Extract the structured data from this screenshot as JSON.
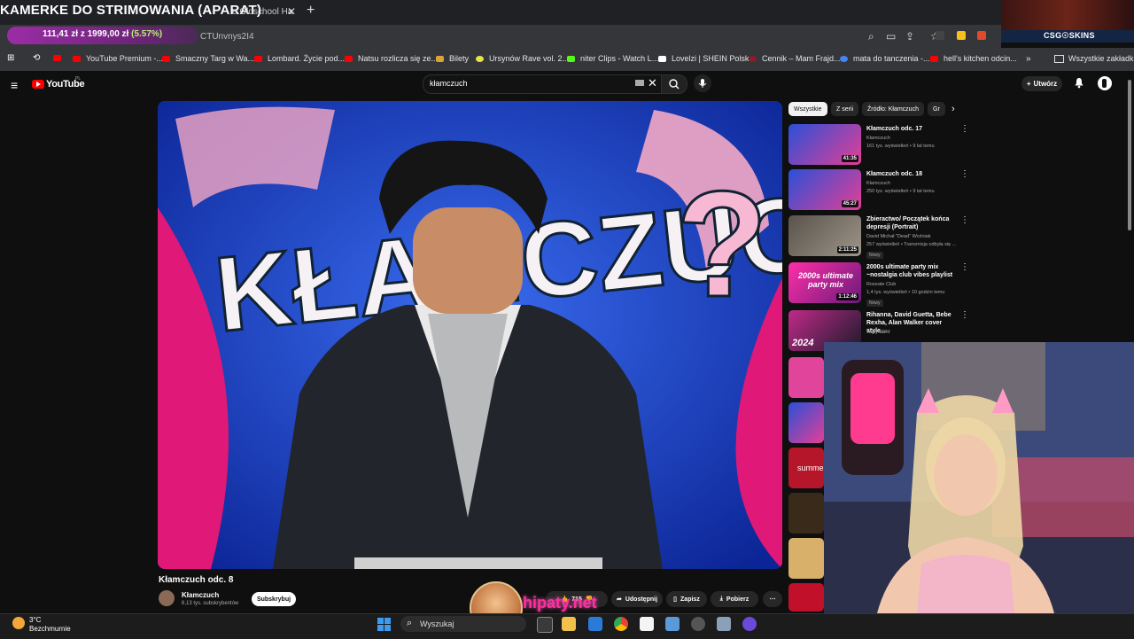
{
  "stream_overlay": {
    "title": "KAMERKE DO STRIMOWANIA (APARAT)",
    "goal_current": "111,41 zł",
    "goal_sep": "z",
    "goal_target": "1999,00 zł",
    "goal_pct": "(5.57%)",
    "sponsor": "CSG☉SKINS",
    "watermark": "hipaty.net"
  },
  "browser": {
    "tab_title_fragment": "e Oldschool Ha",
    "url_fragment": "CTUnvnys2I4",
    "bookmarks": [
      "YouTube Premium -...",
      "Smaczny Targ w Wa...",
      "Lombard. Życie pod...",
      "Natsu rozlicza się ze...",
      "Bilety",
      "Ursynów Rave vol. 2...",
      "niter Clips - Watch L...",
      "Lovelzi | SHEIN Polska",
      "Cennik – Mam Frajd...",
      "mata do tanczenia -...",
      "hell's kitchen odcin..."
    ],
    "all_bookmarks": "Wszystkie zakładki"
  },
  "youtube": {
    "logo_text": "YouTube",
    "region": "PL",
    "search_value": "kłamczuch",
    "create_label": "Utwórz",
    "video_title": "Kłamczuch odc. 8",
    "channel_name": "Kłamczuch",
    "channel_subs": "6,13 tys. subskrybentów",
    "subscribe_label": "Subskrybuj",
    "likes": "715",
    "share_label": "Udostępnij",
    "save_label": "Zapisz",
    "download_label": "Pobierz",
    "chips": [
      "Wszystkie",
      "Z serii",
      "Źródło: Kłamczuch",
      "Gr"
    ],
    "recommendations": [
      {
        "title": "Kłamczuch odc. 17",
        "channel": "Kłamczuch",
        "meta": "161 tys. wyświetleń • 9 lat temu",
        "duration": "41:35",
        "badge": ""
      },
      {
        "title": "Kłamczuch odc. 18",
        "channel": "Kłamczuch",
        "meta": "250 tys. wyświetleń • 9 lat temu",
        "duration": "45:27",
        "badge": ""
      },
      {
        "title": "Zbieractwo/ Początek końca depresji (Portrait)",
        "channel": "David Michał \"Dead\" Woźniak",
        "meta": "257 wyświetleń • Transmisja odbyła się ...",
        "duration": "2:11:25",
        "badge": "Nowy"
      },
      {
        "title": "2000s ultimate party mix ~nostalgia club vibes playlist",
        "channel": "Roseate Club",
        "meta": "1,4 tys. wyświetleń • 10 godzin temu",
        "duration": "1:12:46",
        "badge": "Nowy"
      },
      {
        "title": "Rihanna, David Guetta, Bebe Rexha, Alan Walker cover style...",
        "channel": "Tasty EDM",
        "meta": "",
        "duration": "",
        "badge": ""
      }
    ],
    "thumb_texts": {
      "party": "2000s ultimate party mix",
      "year": "2024",
      "summer": "summe"
    }
  },
  "video_sign": {
    "line1": "KŁAMCZUCH",
    "q": "?"
  },
  "taskbar": {
    "temperature": "3°C",
    "weather": "Bezchmurnie",
    "search_placeholder": "Wyszukaj"
  }
}
